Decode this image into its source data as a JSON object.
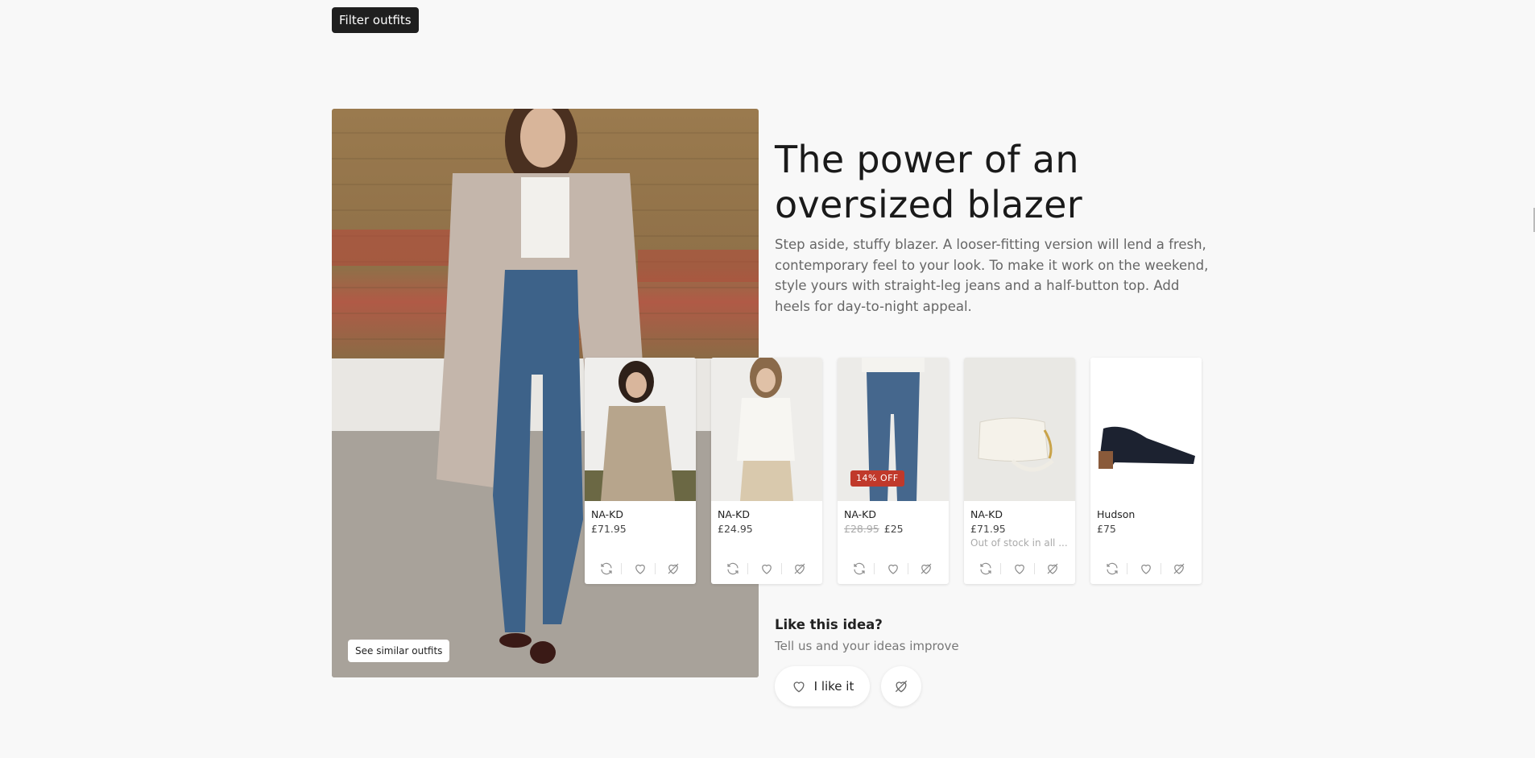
{
  "toolbar": {
    "filter_label": "Filter outfits"
  },
  "outfit": {
    "title": "The power of an oversized blazer",
    "description": "Step aside, stuffy blazer. A looser-fitting version will lend a fresh, contemporary feel to your look. To make it work on the weekend, style yours with straight-leg jeans and a half-button top. Add heels for day-to-night appeal.",
    "similar_label": "See similar outfits"
  },
  "products": [
    {
      "brand": "NA-KD",
      "price": "£71.95",
      "old_price": "",
      "badge": "",
      "stock": ""
    },
    {
      "brand": "NA-KD",
      "price": "£24.95",
      "old_price": "",
      "badge": "",
      "stock": ""
    },
    {
      "brand": "NA-KD",
      "price": "£25",
      "old_price": "£28.95",
      "badge": "14% OFF",
      "stock": ""
    },
    {
      "brand": "NA-KD",
      "price": "£71.95",
      "old_price": "",
      "badge": "",
      "stock": "Out of stock in all ..."
    },
    {
      "brand": "Hudson",
      "price": "£75",
      "old_price": "",
      "badge": "",
      "stock": ""
    }
  ],
  "feedback": {
    "question": "Like this idea?",
    "subtitle": "Tell us and your ideas improve",
    "like_label": "I like it"
  },
  "colors": {
    "badge": "#c0392b",
    "dark_button": "#1f1f1f",
    "background": "#f8f8f8"
  },
  "icons": [
    "refresh-icon",
    "heart-icon",
    "heart-broken-icon"
  ]
}
